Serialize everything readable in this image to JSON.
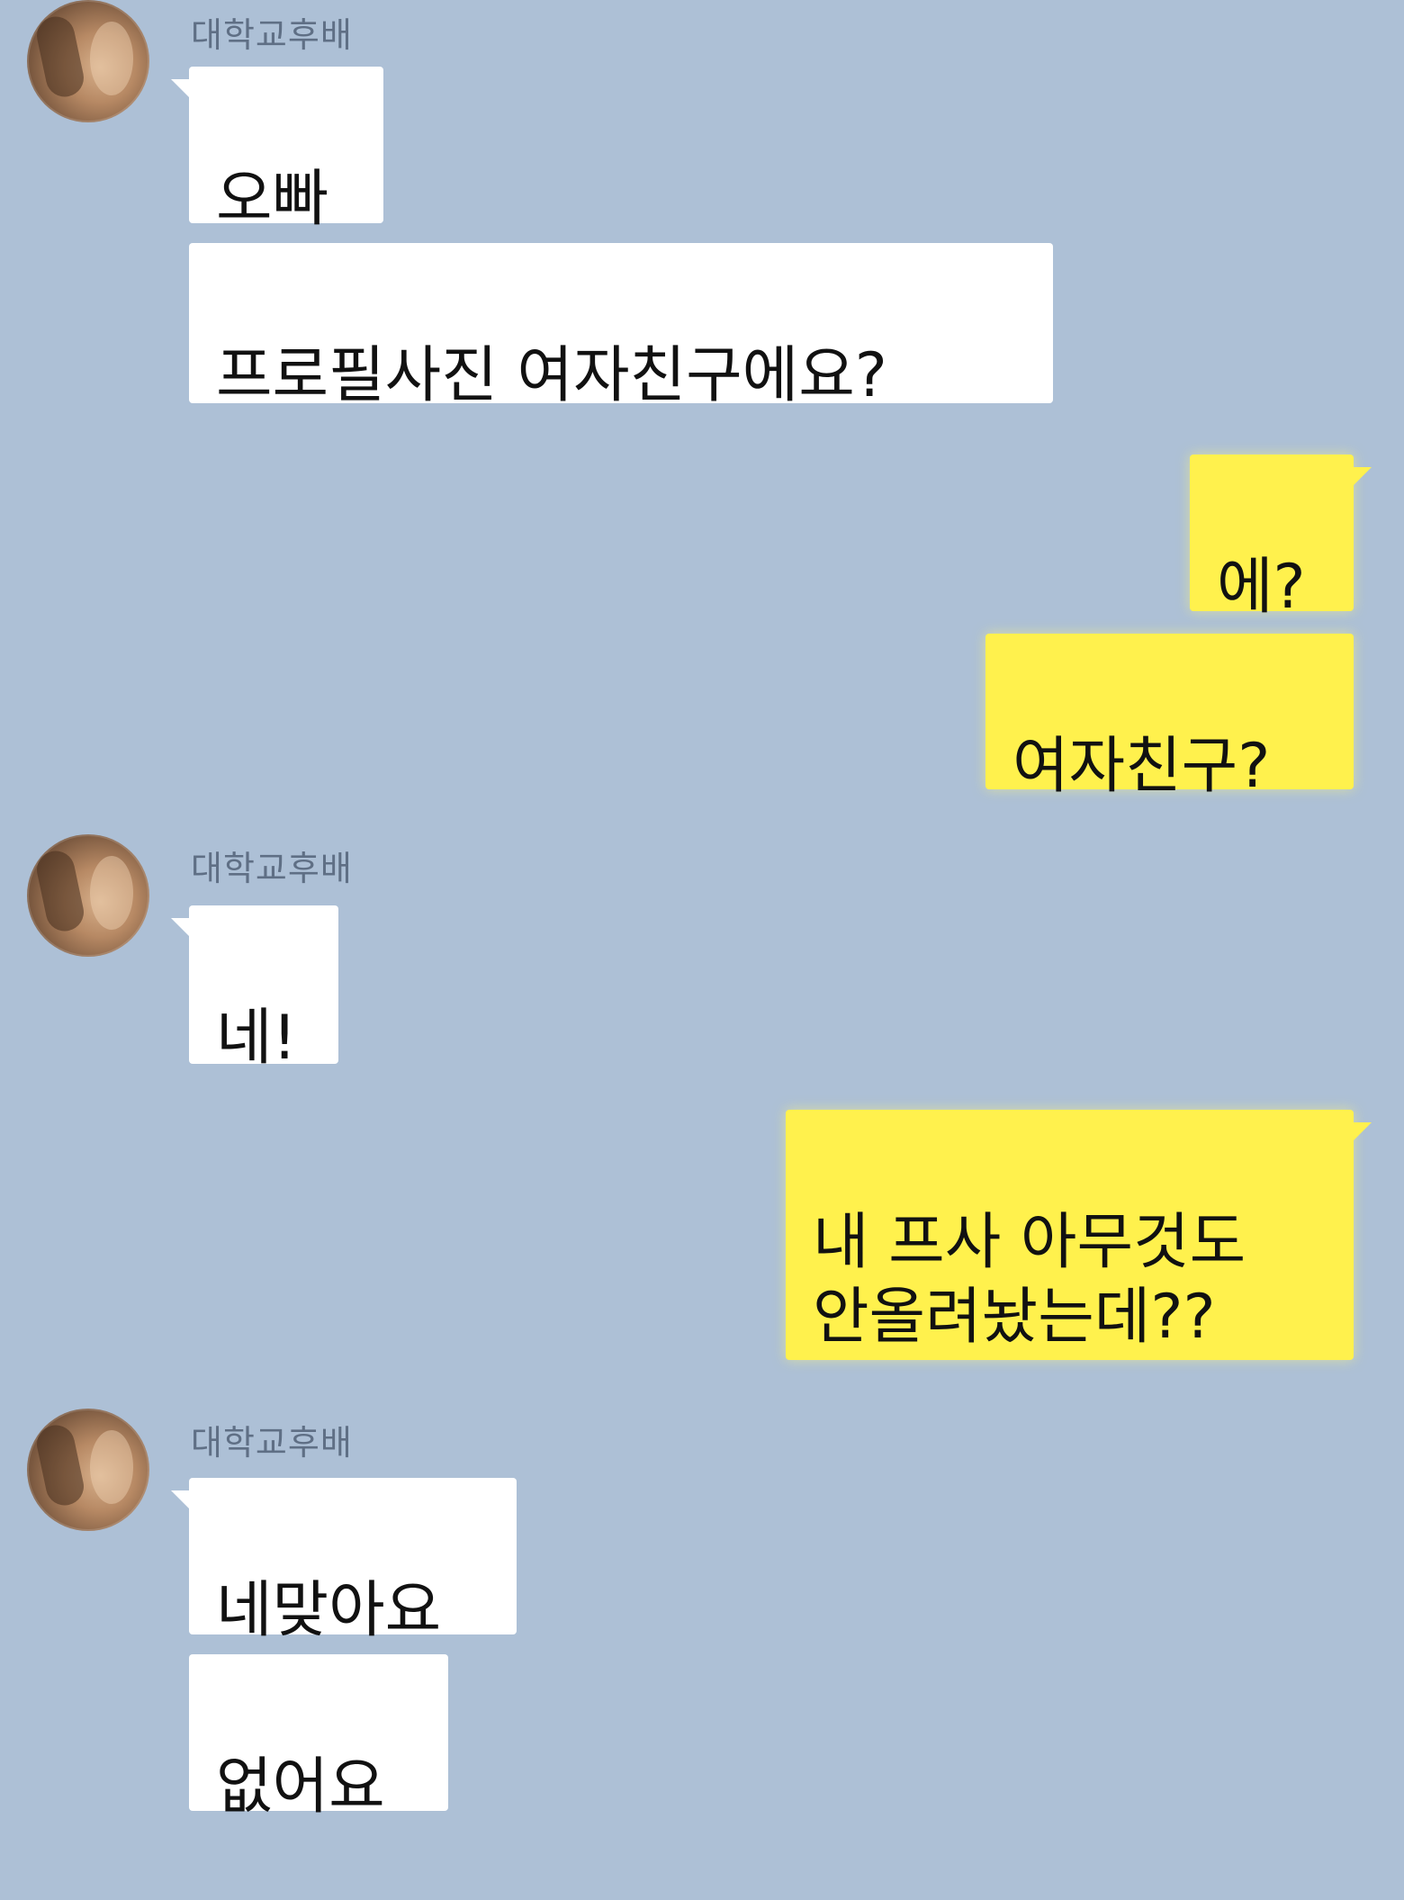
{
  "chat": {
    "messages": [
      {
        "sender_name": "대학교후배",
        "text": "오빠"
      },
      {
        "text": "프로필사진 여자친구에요?"
      },
      {
        "text": "에?"
      },
      {
        "text": "여자친구?"
      },
      {
        "sender_name": "대학교후배",
        "text": "네!"
      },
      {
        "text": "내 프사 아무것도\n안올려놨는데??"
      },
      {
        "sender_name": "대학교후배",
        "text": "네맞아요"
      },
      {
        "text": "없어요"
      }
    ]
  }
}
